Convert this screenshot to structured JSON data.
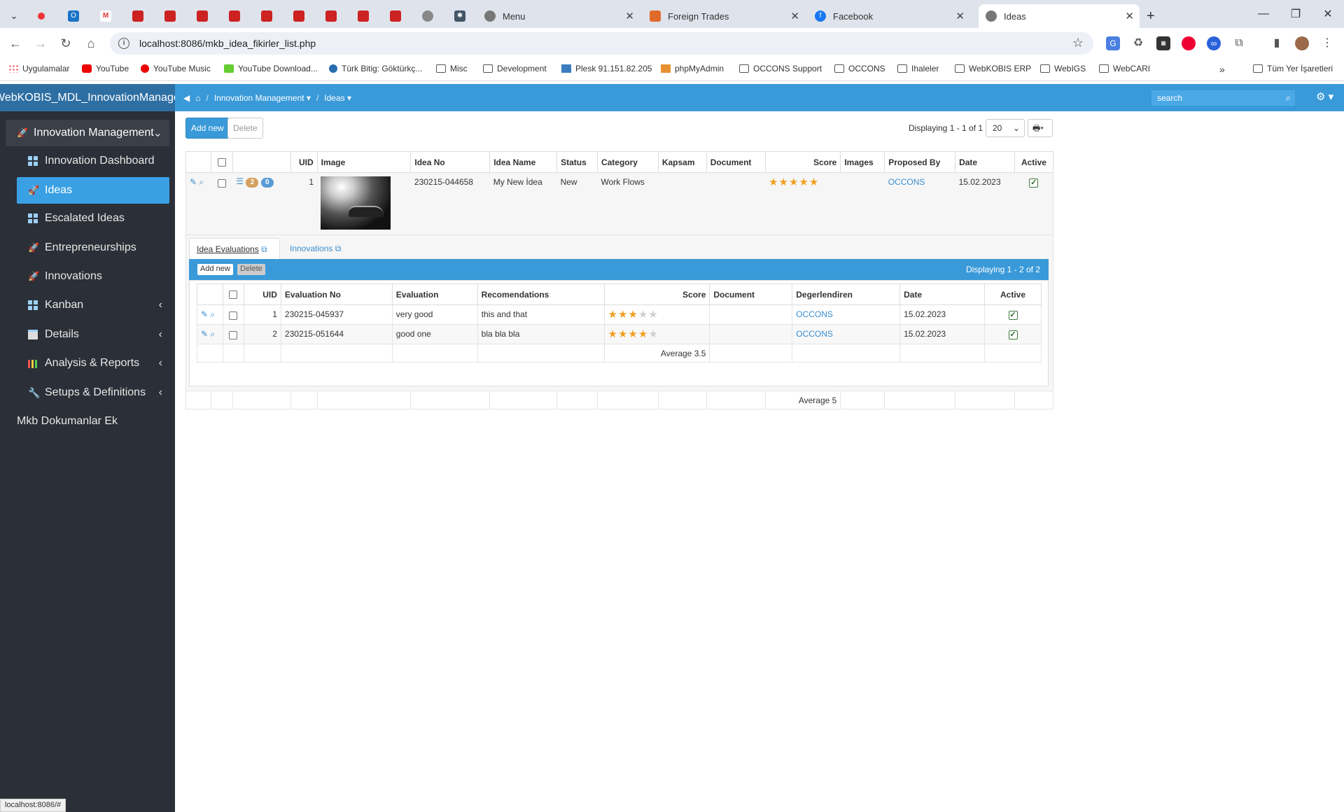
{
  "browser": {
    "tabs": [
      {
        "label": "Menu"
      },
      {
        "label": "Foreign Trades"
      },
      {
        "label": "Facebook"
      },
      {
        "label": "Ideas"
      }
    ],
    "new_tab": "+",
    "url": "localhost:8086/mkb_idea_fikirler_list.php",
    "bookmarks": [
      "Uygulamalar",
      "YouTube",
      "YouTube Music",
      "YouTube Download...",
      "Türk Bitig: Göktürkç...",
      "Misc",
      "Development",
      "Plesk 91.151.82.205",
      "phpMyAdmin",
      "OCCONS Support",
      "OCCONS",
      "Ihaleler",
      "WebKOBIS ERP",
      "WebIGS",
      "WebCARI"
    ],
    "bookmarks_more": "»",
    "bookmarks_other": "Tüm Yer İşaretleri"
  },
  "app": {
    "brand": "WebKOBIS_MDL_InnovationManagement",
    "breadcrumb": [
      "Innovation Management",
      "Ideas"
    ],
    "search_placeholder": "search"
  },
  "sidebar": {
    "items": [
      {
        "label": "Innovation Management",
        "icon": "rocket-icon"
      },
      {
        "label": "Innovation Dashboard",
        "icon": "grid-icon"
      },
      {
        "label": "Ideas",
        "icon": "rocket-icon"
      },
      {
        "label": "Escalated Ideas",
        "icon": "grid-icon"
      },
      {
        "label": "Entrepreneurships",
        "icon": "rocket-icon"
      },
      {
        "label": "Innovations",
        "icon": "rocket-icon"
      },
      {
        "label": "Kanban",
        "icon": "grid-icon"
      },
      {
        "label": "Details",
        "icon": "doc-icon"
      },
      {
        "label": "Analysis & Reports",
        "icon": "chart-icon"
      },
      {
        "label": "Setups & Definitions",
        "icon": "wrench-icon"
      },
      {
        "label": "Mkb Dokumanlar Ek",
        "icon": ""
      }
    ]
  },
  "toolbar": {
    "add_new": "Add new",
    "delete": "Delete",
    "displaying": "Displaying 1 - 1 of 1",
    "page_size": "20"
  },
  "ideas_table": {
    "columns": [
      "UID",
      "Image",
      "Idea No",
      "Idea Name",
      "Status",
      "Category",
      "Kapsam",
      "Document",
      "Score",
      "Images",
      "Proposed By",
      "Date",
      "Active"
    ],
    "row": {
      "badge_a": "2",
      "badge_b": "0",
      "uid": "1",
      "idea_no": "230215-044658",
      "idea_name": "My New İdea",
      "status": "New",
      "category": "Work Flows",
      "score_stars": 5,
      "proposed_by": "OCCONS",
      "date": "15.02.2023",
      "active": true
    },
    "footer_average": "Average 5"
  },
  "subtabs": [
    "Idea Evaluations",
    "Innovations"
  ],
  "evaluations": {
    "add_new": "Add new",
    "delete": "Delete",
    "displaying": "Displaying 1 - 2 of 2",
    "columns": [
      "UID",
      "Evaluation No",
      "Evaluation",
      "Recomendations",
      "Score",
      "Document",
      "Degerlendiren",
      "Date",
      "Active"
    ],
    "rows": [
      {
        "uid": "1",
        "no": "230215-045937",
        "evaluation": "very good",
        "recommendation": "this and that",
        "stars": 3,
        "by": "OCCONS",
        "date": "15.02.2023"
      },
      {
        "uid": "2",
        "no": "230215-051644",
        "evaluation": "good one",
        "recommendation": "bla bla bla",
        "stars": 4,
        "by": "OCCONS",
        "date": "15.02.2023"
      }
    ],
    "footer_average": "Average 3.5"
  },
  "status_url": "localhost:8086/#",
  "colors": {
    "header": "#3a9ad9",
    "sidebar": "#2b2f37",
    "accent": "#3a8ed0",
    "star": "#f0a020"
  }
}
